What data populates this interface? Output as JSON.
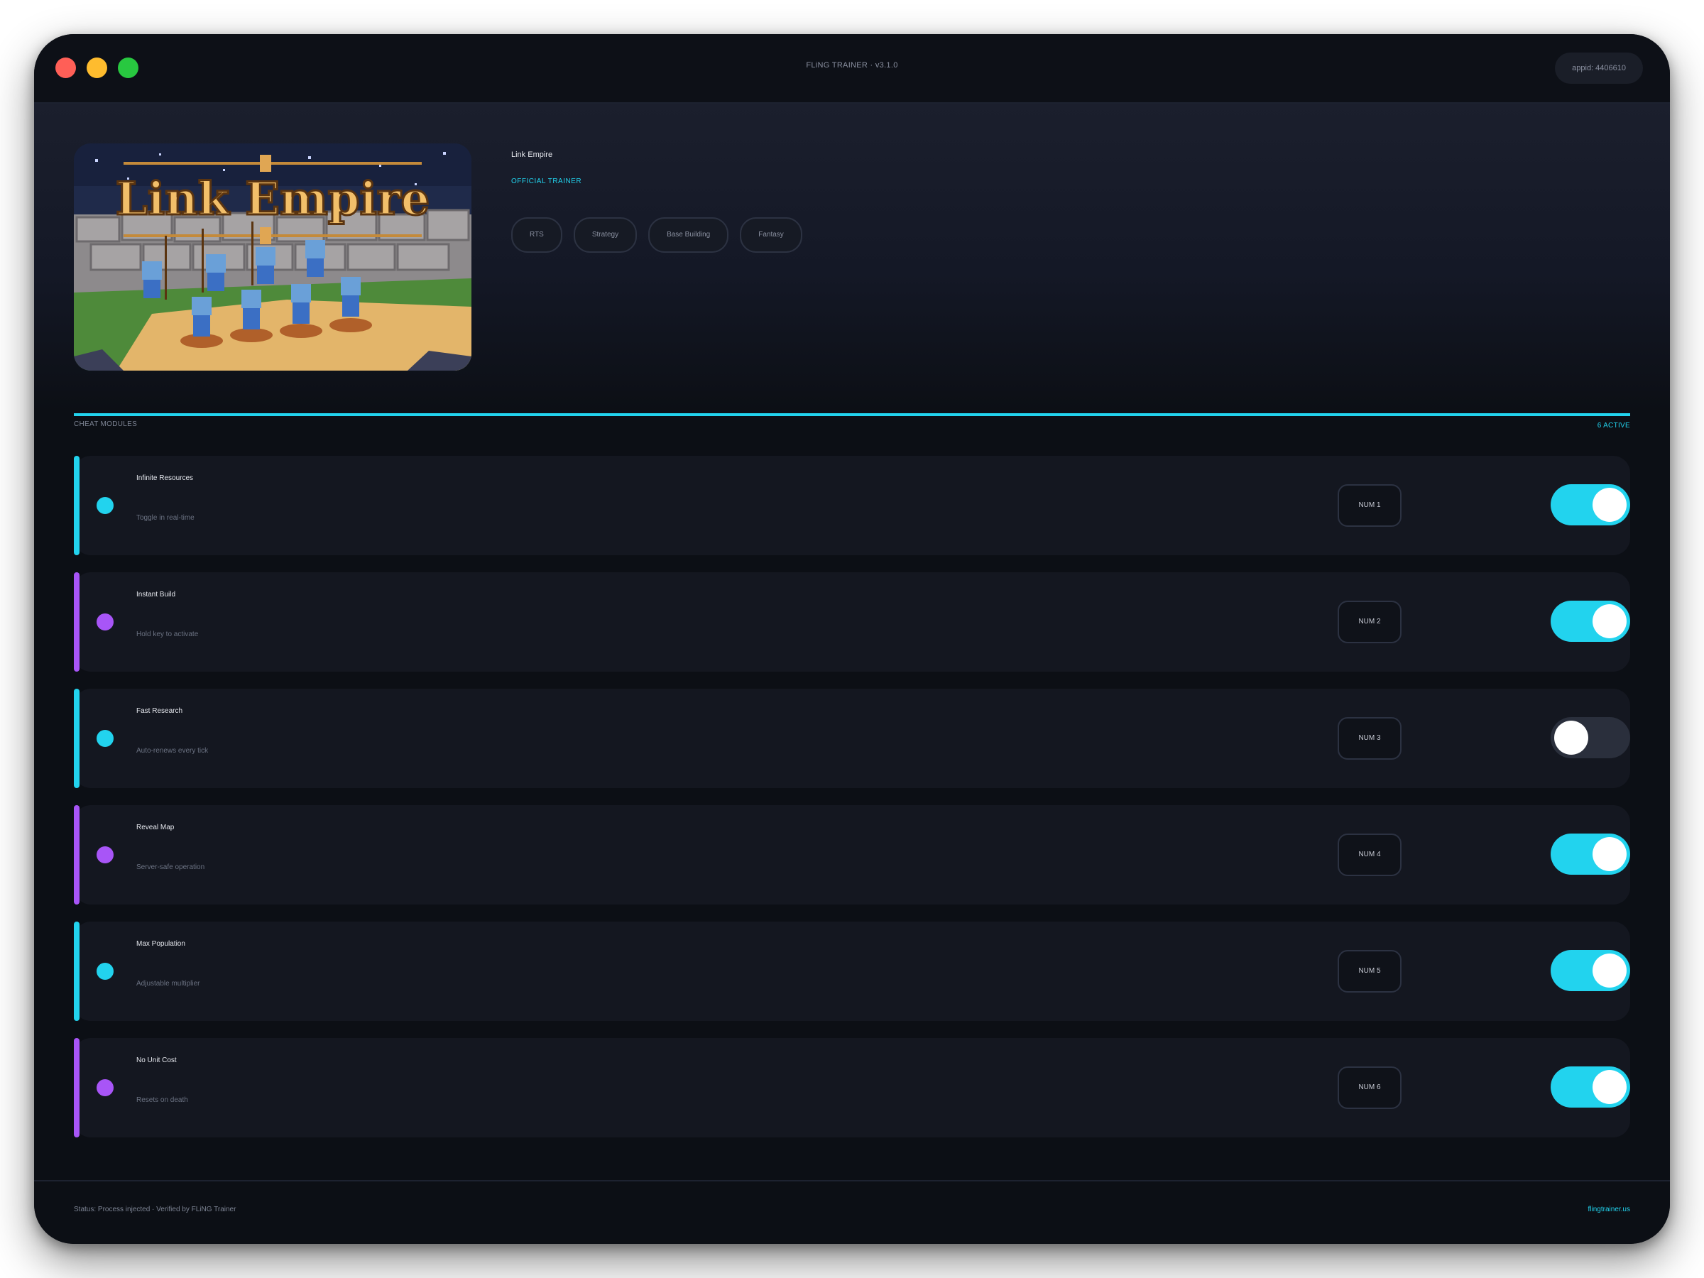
{
  "window": {
    "title": "FLiNG TRAINER · v3.1.0",
    "appid": "appid: 4406610"
  },
  "hero": {
    "cover_title": "Link Empire",
    "game_name": "Link Empire",
    "badge": "OFFICIAL TRAINER",
    "tags": [
      "RTS",
      "Strategy",
      "Base Building",
      "Fantasy"
    ]
  },
  "section": {
    "label": "CHEAT MODULES",
    "active_count": "6 ACTIVE"
  },
  "colors": {
    "accent_cyan": "#22d3ee",
    "accent_purple": "#a855f7",
    "toggle_off": "#2a2f3c"
  },
  "modules": [
    {
      "name": "Infinite Resources",
      "desc": "Toggle in real-time",
      "hotkey": "NUM 1",
      "enabled": true,
      "accent": "cyan"
    },
    {
      "name": "Instant Build",
      "desc": "Hold key to activate",
      "hotkey": "NUM 2",
      "enabled": true,
      "accent": "purple"
    },
    {
      "name": "Fast Research",
      "desc": "Auto-renews every tick",
      "hotkey": "NUM 3",
      "enabled": false,
      "accent": "cyan"
    },
    {
      "name": "Reveal Map",
      "desc": "Server-safe operation",
      "hotkey": "NUM 4",
      "enabled": true,
      "accent": "purple"
    },
    {
      "name": "Max Population",
      "desc": "Adjustable multiplier",
      "hotkey": "NUM 5",
      "enabled": true,
      "accent": "cyan"
    },
    {
      "name": "No Unit Cost",
      "desc": "Resets on death",
      "hotkey": "NUM 6",
      "enabled": true,
      "accent": "purple"
    }
  ],
  "footer": {
    "status": "Status: Process injected · Verified by FLiNG Trainer",
    "link": "flingtrainer.us"
  }
}
